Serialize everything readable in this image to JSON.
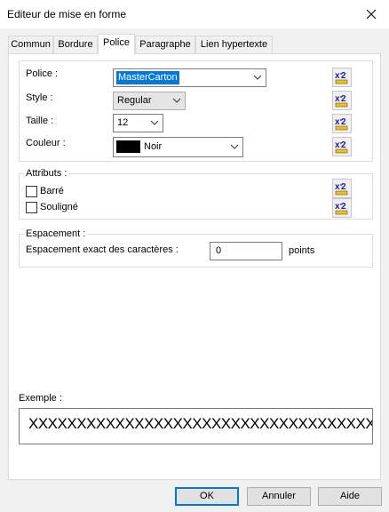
{
  "window": {
    "title": "Editeur de mise en forme"
  },
  "tabs": [
    {
      "label": "Commun"
    },
    {
      "label": "Bordure"
    },
    {
      "label": "Police"
    },
    {
      "label": "Paragraphe"
    },
    {
      "label": "Lien hypertexte"
    }
  ],
  "font_section": {
    "font_label": "Police :",
    "font_value": "MasterCarton",
    "style_label": "Style :",
    "style_value": "Regular",
    "size_label": "Taille :",
    "size_value": "12",
    "color_label": "Couleur :",
    "color_value": "Noir",
    "color_swatch": "#000000"
  },
  "attributes": {
    "group_label": "Attributs :",
    "strikethrough_label": "Barré",
    "strikethrough_checked": false,
    "underline_label": "Souligné",
    "underline_checked": false
  },
  "spacing": {
    "group_label": "Espacement :",
    "exact_label": "Espacement exact des caractères :",
    "value": "0",
    "unit": "points"
  },
  "example": {
    "label": "Exemple :",
    "preview_text": "XXXXXXXXXXXXXXXXXXXXXXXXXXXXXXXXXXXXXXXXXX"
  },
  "footer": {
    "ok_label": "OK",
    "cancel_label": "Annuler",
    "help_label": "Aide"
  },
  "icons": {
    "x2_button": "x2-format-icon",
    "close": "close-icon",
    "dropdown": "chevron-down-icon"
  },
  "colors": {
    "accent": "#0078d7",
    "dialog_bg": "#f0f0f0",
    "x2_yellow": "#f4c400",
    "x2_blue": "#1a1aa6"
  }
}
